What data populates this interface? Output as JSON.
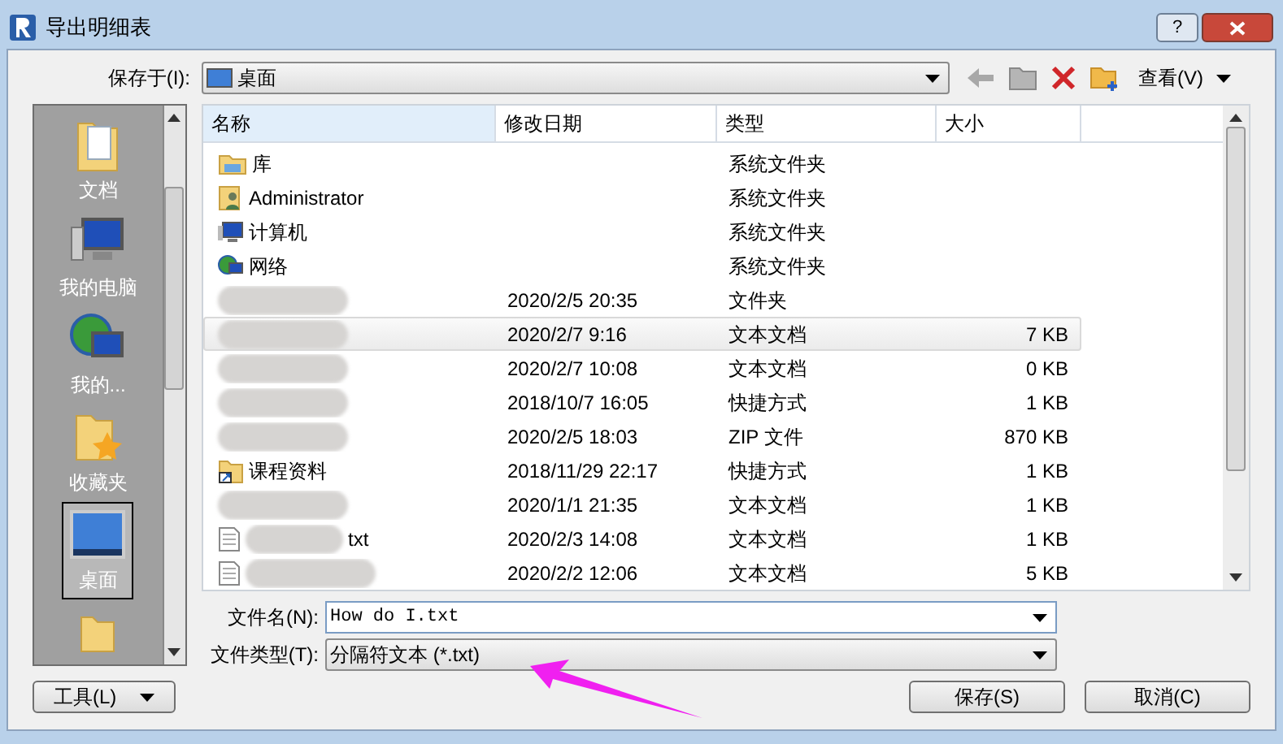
{
  "window": {
    "title": "导出明细表",
    "buttons": [
      "?"
    ]
  },
  "save_in": {
    "label": "保存于(I):",
    "value": "桌面"
  },
  "toolbar": {
    "view_label": "查看(V)"
  },
  "sidebar": {
    "items": [
      {
        "label": "文档",
        "kind": "documents",
        "selected": false
      },
      {
        "label": "我的电脑",
        "kind": "computer",
        "selected": false
      },
      {
        "label": "我的...",
        "kind": "network",
        "selected": false
      },
      {
        "label": "收藏夹",
        "kind": "favorites",
        "selected": false
      },
      {
        "label": "桌面",
        "kind": "desktop",
        "selected": true
      },
      {
        "kind": "folder",
        "selected": false
      }
    ]
  },
  "table": {
    "columns": [
      "名称",
      "修改日期",
      "类型",
      "大小"
    ],
    "rows": [
      {
        "kind": "library",
        "name": "库",
        "type": "系统文件夹",
        "selected": false
      },
      {
        "kind": "user",
        "name": "Administrator",
        "type": "系统文件夹",
        "selected": false
      },
      {
        "kind": "computer",
        "name": "计算机",
        "type": "系统文件夹",
        "selected": false
      },
      {
        "kind": "network",
        "name": "网络",
        "type": "系统文件夹",
        "selected": false
      },
      {
        "kind": "blurred",
        "date": "2020/2/5 20:35",
        "type": "文件夹",
        "selected": false
      },
      {
        "kind": "blurred",
        "date": "2020/2/7 9:16",
        "type": "文本文档",
        "size": "7 KB",
        "selected": true
      },
      {
        "kind": "blurred",
        "date": "2020/2/7 10:08",
        "type": "文本文档",
        "size": "0 KB",
        "selected": false
      },
      {
        "kind": "blurred",
        "date": "2018/10/7 16:05",
        "type": "快捷方式",
        "size": "1 KB",
        "selected": false
      },
      {
        "kind": "blurred",
        "date": "2020/2/5 18:03",
        "type": "ZIP 文件",
        "size": "870 KB",
        "selected": false
      },
      {
        "kind": "shortcut",
        "name": "课程资料",
        "date": "2018/11/29 22:17",
        "type": "快捷方式",
        "size": "1 KB",
        "selected": false
      },
      {
        "kind": "blurred",
        "date": "2020/1/1 21:35",
        "type": "文本文档",
        "size": "1 KB",
        "selected": false
      },
      {
        "kind": "text",
        "name": "txt",
        "blurred": true,
        "date": "2020/2/3 14:08",
        "type": "文本文档",
        "size": "1 KB",
        "selected": false
      },
      {
        "kind": "text",
        "blurred": true,
        "date": "2020/2/2 12:06",
        "type": "文本文档",
        "size": "5 KB",
        "selected": false
      }
    ]
  },
  "file_name": {
    "label": "文件名(N):",
    "value": "How do I.txt"
  },
  "file_type": {
    "label": "文件类型(T):",
    "value": "分隔符文本 (*.txt)"
  },
  "tools_button": "工具(L)",
  "buttons": [
    "保存(S)",
    "取消(C)"
  ]
}
